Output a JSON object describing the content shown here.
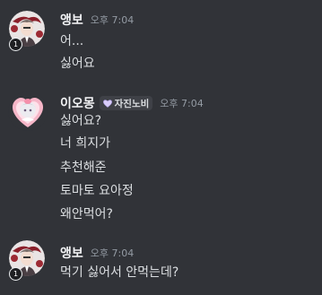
{
  "messages": [
    {
      "username": "앵보",
      "timestamp": "오후 7:04",
      "badge": "1",
      "lines": [
        "어...",
        "싫어요"
      ]
    },
    {
      "username": "이오몽",
      "timestamp": "오후 7:04",
      "role": "자진노비",
      "lines": [
        "싫어요?",
        "너 희지가",
        "추천해준",
        "토마토 요아정",
        "왜안먹어?"
      ]
    },
    {
      "username": "앵보",
      "timestamp": "오후 7:04",
      "badge": "1",
      "lines": [
        "먹기 싫어서 안먹는데?"
      ]
    }
  ],
  "colors": {
    "background": "#313338",
    "username": "#f2f3f5",
    "timestamp": "#949ba4",
    "text": "#dbdee1"
  }
}
